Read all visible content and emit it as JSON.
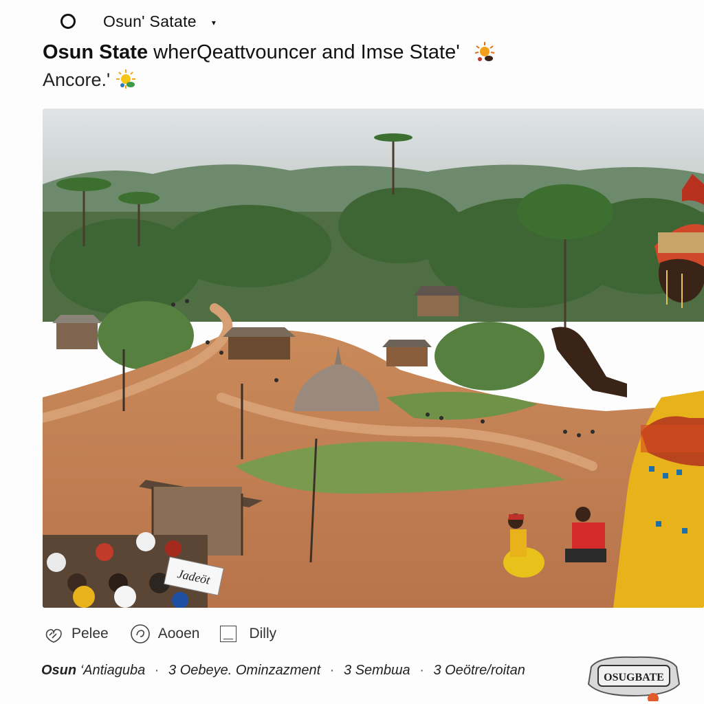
{
  "topbar": {
    "account_name": "Osun' Satate",
    "caret": "▾"
  },
  "headline": {
    "bold": "Osun State",
    "rest": " wherQeattvouncer and Imse State'",
    "line2": "Ancore.'"
  },
  "photo": {
    "sign_text": "Jadeöt"
  },
  "actions": [
    {
      "label": "Pelee",
      "icon": "like-icon"
    },
    {
      "label": "Aooen",
      "icon": "share-icon"
    },
    {
      "label": "Dilly",
      "icon": "save-icon"
    }
  ],
  "footer": {
    "brand": "Osun",
    "parts": [
      "‘Antiaguba",
      "3 Oebeye. Ominzazment",
      "3 Sembша",
      "3 Oeötre/roitan"
    ],
    "separator": "·"
  },
  "stamp": {
    "text": "OSUGBATE"
  },
  "colors": {
    "text": "#111111",
    "background": "#fdfdfd",
    "accent_gold": "#e8b21a"
  }
}
